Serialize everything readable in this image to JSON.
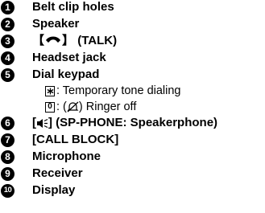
{
  "items": [
    {
      "number": "1",
      "label": "Belt clip holes"
    },
    {
      "number": "2",
      "label": "Speaker"
    },
    {
      "number": "3",
      "label": "(TALK)",
      "icon": "phone-handset-icon"
    },
    {
      "number": "4",
      "label": "Headset jack"
    },
    {
      "number": "5",
      "label": "Dial keypad"
    },
    {
      "number": "6",
      "label": "(SP-PHONE: Speakerphone)",
      "icon": "speaker-icon"
    },
    {
      "number": "7",
      "label": "CALL BLOCK"
    },
    {
      "number": "8",
      "label": "Microphone"
    },
    {
      "number": "9",
      "label": "Receiver"
    },
    {
      "number": "10",
      "label": "Display"
    }
  ],
  "subitems": [
    {
      "key": "*",
      "text": ": Temporary tone dialing"
    },
    {
      "key": "0",
      "text": ": (",
      "icon": "ringer-off-icon",
      "text_after": ") Ringer off"
    }
  ]
}
